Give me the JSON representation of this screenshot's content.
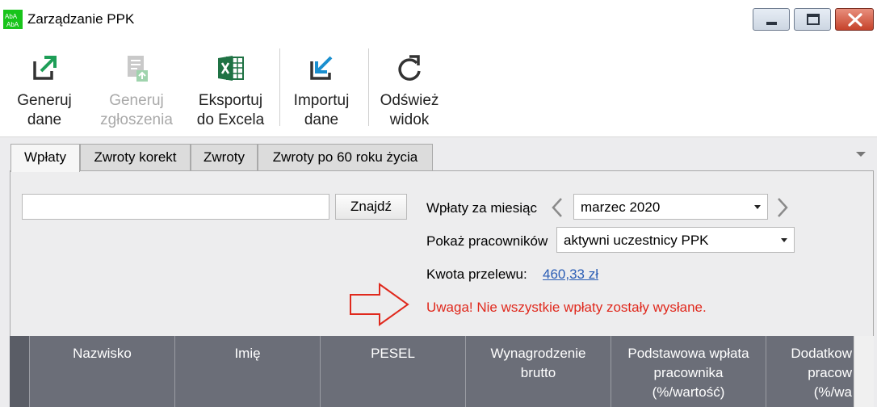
{
  "window": {
    "title": "Zarządzanie PPK",
    "icon": "spreadsheet-app-icon"
  },
  "ribbon": {
    "buttons": [
      {
        "line1": "Generuj",
        "line2": "dane",
        "icon": "export-arrow-icon",
        "enabled": true
      },
      {
        "line1": "Generuj",
        "line2": "zgłoszenia",
        "icon": "document-upload-icon",
        "enabled": false
      },
      {
        "line1": "Eksportuj",
        "line2": "do Excela",
        "icon": "excel-icon",
        "enabled": true
      },
      {
        "line1": "Importuj",
        "line2": "dane",
        "icon": "import-arrow-icon",
        "enabled": true
      },
      {
        "line1": "Odśwież",
        "line2": "widok",
        "icon": "refresh-icon",
        "enabled": true
      }
    ]
  },
  "tabs": [
    {
      "label": "Wpłaty",
      "active": true
    },
    {
      "label": "Zwroty korekt",
      "active": false
    },
    {
      "label": "Zwroty",
      "active": false
    },
    {
      "label": "Zwroty po 60 roku życia",
      "active": false
    }
  ],
  "filters": {
    "search_value": "",
    "find_label": "Znajdź",
    "month_label": "Wpłaty za miesiąc",
    "month_value": "marzec 2020",
    "employees_label": "Pokaż pracowników",
    "employees_value": "aktywni uczestnicy PPK",
    "transfer_label": "Kwota przelewu:",
    "transfer_value": "460,33 zł"
  },
  "warning": {
    "text": "Uwaga! Nie wszystkie wpłaty zostały wysłane.",
    "color": "#e0291d"
  },
  "grid": {
    "columns": [
      {
        "line1": "Nazwisko",
        "line2": "",
        "line3": ""
      },
      {
        "line1": "Imię",
        "line2": "",
        "line3": ""
      },
      {
        "line1": "PESEL",
        "line2": "",
        "line3": ""
      },
      {
        "line1": "Wynagrodzenie",
        "line2": "brutto",
        "line3": ""
      },
      {
        "line1": "Podstawowa wpłata",
        "line2": "pracownika",
        "line3": "(%/wartość)"
      },
      {
        "line1": "Dodatkow",
        "line2": "pracow",
        "line3": "(%/wa"
      }
    ]
  },
  "colors": {
    "header_bg": "#6b6e78",
    "link": "#2a5db5",
    "excel_green": "#1f7244",
    "accent_arrow": "#1e9e57",
    "import_arrow": "#1a8fcf"
  }
}
